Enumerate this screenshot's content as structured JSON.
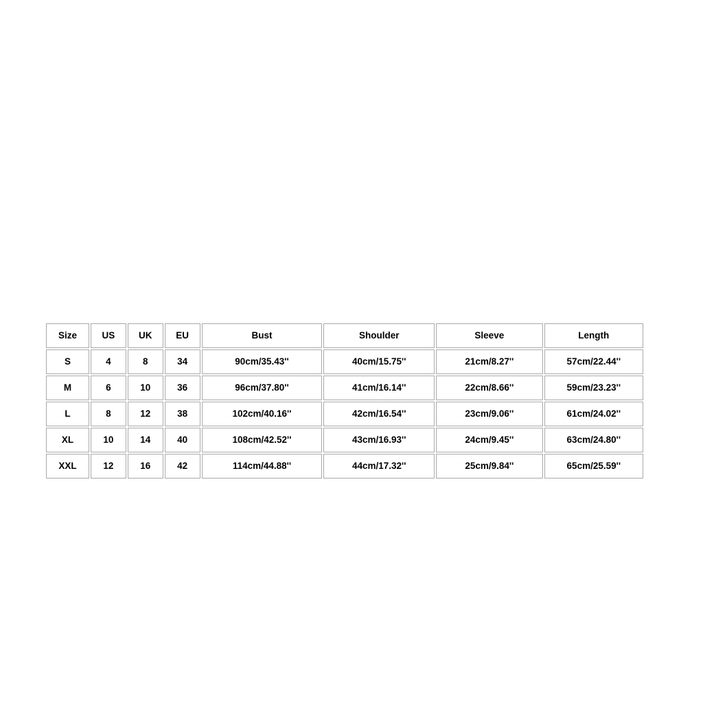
{
  "size_chart": {
    "type": "table",
    "columns": [
      "Size",
      "US",
      "UK",
      "EU",
      "Bust",
      "Shoulder",
      "Sleeve",
      "Length"
    ],
    "rows": [
      {
        "size": "S",
        "us": "4",
        "uk": "8",
        "eu": "34",
        "bust": "90cm/35.43''",
        "shoulder": "40cm/15.75''",
        "sleeve": "21cm/8.27''",
        "length": "57cm/22.44''"
      },
      {
        "size": "M",
        "us": "6",
        "uk": "10",
        "eu": "36",
        "bust": "96cm/37.80''",
        "shoulder": "41cm/16.14''",
        "sleeve": "22cm/8.66''",
        "length": "59cm/23.23''"
      },
      {
        "size": "L",
        "us": "8",
        "uk": "12",
        "eu": "38",
        "bust": "102cm/40.16''",
        "shoulder": "42cm/16.54''",
        "sleeve": "23cm/9.06''",
        "length": "61cm/24.02''"
      },
      {
        "size": "XL",
        "us": "10",
        "uk": "14",
        "eu": "40",
        "bust": "108cm/42.52''",
        "shoulder": "43cm/16.93''",
        "sleeve": "24cm/9.45''",
        "length": "63cm/24.80''"
      },
      {
        "size": "XXL",
        "us": "12",
        "uk": "16",
        "eu": "42",
        "bust": "114cm/44.88''",
        "shoulder": "44cm/17.32''",
        "sleeve": "25cm/9.84''",
        "length": "65cm/25.59''"
      }
    ],
    "colors": {
      "text": "#000000",
      "border": "#a8a8a8",
      "background": "#ffffff"
    }
  }
}
